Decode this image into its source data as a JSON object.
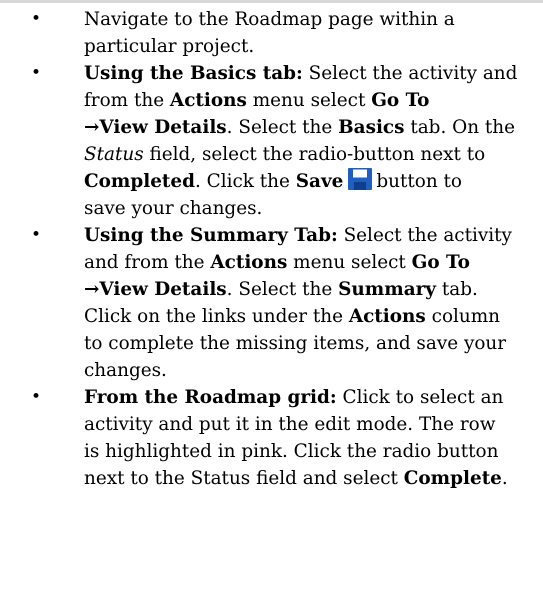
{
  "colors": {
    "save_icon": "#1f5fbf",
    "top_rule": "#d8d8d8"
  },
  "items": [
    {
      "bullet": "•",
      "lines": [
        [
          "Navigate to the Roadmap page within a"
        ],
        [
          "particular project."
        ]
      ]
    },
    {
      "bullet": "•",
      "lines": [
        [
          "Using the Basics tab:",
          " Select the activity and"
        ],
        [
          "from the ",
          "Actions",
          " menu select ",
          "Go To"
        ],
        [
          "→View Details",
          ". Select the ",
          "Basics",
          " tab. On the"
        ],
        [
          "Status",
          " field, select the radio-button next to"
        ],
        [
          "Completed",
          ". Click the ",
          "Save",
          "button to"
        ],
        [
          "save your changes."
        ]
      ]
    },
    {
      "bullet": "•",
      "lines": [
        [
          "Using the Summary Tab:",
          " Select the activity"
        ],
        [
          "and from the ",
          "Actions",
          " menu select ",
          "Go To"
        ],
        [
          "→View Details",
          ". Select the ",
          "Summary",
          " tab."
        ],
        [
          "Click on the links under the ",
          "Actions",
          " column"
        ],
        [
          "to complete the missing items, and save your"
        ],
        [
          "changes."
        ]
      ]
    },
    {
      "bullet": "•",
      "lines": [
        [
          "From the Roadmap grid:",
          " Click to select an"
        ],
        [
          "activity and put it in the edit mode. The row"
        ],
        [
          "is highlighted in pink. Click the radio button"
        ],
        [
          "next to the Status field and select ",
          "Complete",
          "."
        ]
      ]
    }
  ]
}
